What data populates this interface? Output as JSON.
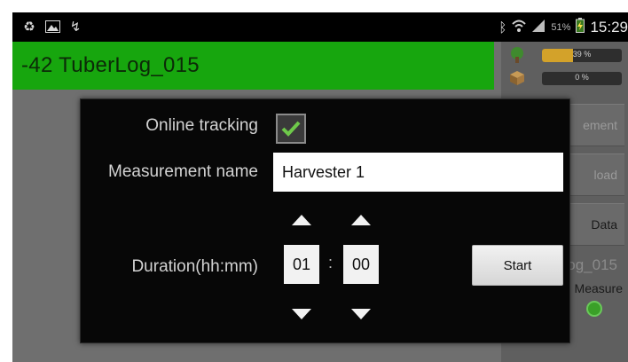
{
  "status_bar": {
    "left_icons": [
      "recycle-icon",
      "picture-icon",
      "usb-icon"
    ],
    "right_icons": [
      "bluetooth-icon",
      "wifi-icon",
      "signal-icon",
      "battery-icon"
    ],
    "battery_percent": "51%",
    "time": "15:29"
  },
  "app": {
    "title": "-42  TuberLog_015",
    "title_bar_color": "#17a60e"
  },
  "side_panel": {
    "meters": [
      {
        "icon": "tree-icon",
        "label": "39 %",
        "fraction": 0.39
      },
      {
        "icon": "box-icon",
        "label": "0 %",
        "fraction": 0.0
      }
    ],
    "buttons": [
      "ement",
      "load",
      "Data"
    ],
    "log_title": "og_015",
    "log_status": "Measure"
  },
  "dialog": {
    "online_tracking_label": "Online tracking",
    "online_tracking_checked": true,
    "measurement_name_label": "Measurement name",
    "measurement_name_value": "Harvester 1",
    "duration_label": "Duration(hh:mm)",
    "hours_value": "01",
    "minutes_value": "00",
    "separator": ":",
    "start_label": "Start"
  }
}
